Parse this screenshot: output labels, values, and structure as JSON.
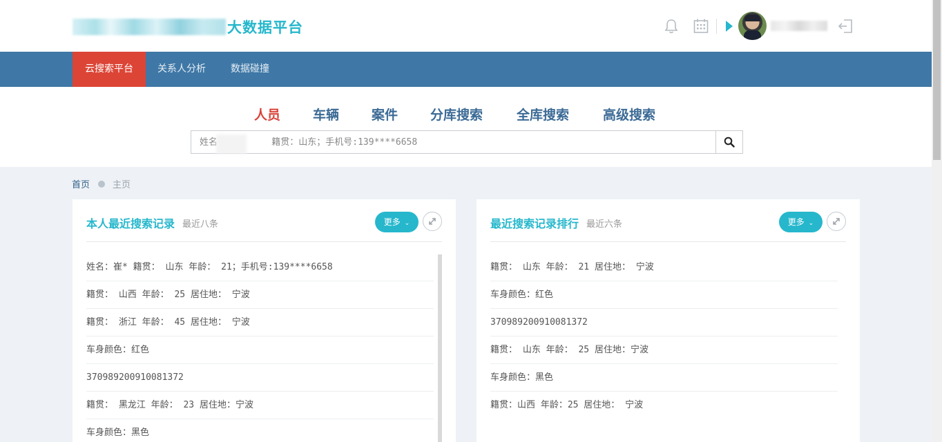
{
  "header": {
    "logo_text": "大数据平台",
    "icons": [
      "bell-icon",
      "calendar-icon",
      "play-icon",
      "logout-icon"
    ]
  },
  "nav": {
    "items": [
      {
        "label": "云搜索平台",
        "active": true
      },
      {
        "label": "关系人分析",
        "active": false
      },
      {
        "label": "数据碰撞",
        "active": false
      }
    ]
  },
  "search": {
    "tabs": [
      "人员",
      "车辆",
      "案件",
      "分库搜索",
      "全库搜索",
      "高级搜索"
    ],
    "active_tab": "人员",
    "placeholder": "姓名          籍贯：山东；手机号:139****6658"
  },
  "breadcrumb": {
    "home": "首页",
    "current": "主页"
  },
  "panels": {
    "left": {
      "title": "本人最近搜索记录",
      "subtitle": "最近八条",
      "more_label": "更多",
      "items": [
        "姓名：崔* 籍贯： 山东 年龄： 21；手机号:139****6658",
        "籍贯： 山西 年龄： 25 居住地： 宁波",
        "籍贯： 浙江 年龄： 45 居住地： 宁波",
        "车身颜色：红色",
        "370989200910081372",
        "籍贯： 黑龙江 年龄： 23 居住地：宁波",
        "车身颜色：黑色"
      ]
    },
    "right": {
      "title": "最近搜索记录排行",
      "subtitle": "最近六条",
      "more_label": "更多",
      "items": [
        "籍贯： 山东 年龄： 21 居住地： 宁波",
        "车身颜色：红色",
        "370989200910081372",
        "籍贯： 山东 年龄： 25 居住地：宁波",
        "车身颜色：黑色",
        "籍贯：山西 年龄：25 居住地： 宁波"
      ]
    }
  },
  "colors": {
    "accent": "#26b7cc",
    "nav_bg": "#3f78a6",
    "nav_active": "#dc4536",
    "tab_active": "#d9433a",
    "tab": "#3b6a95"
  }
}
